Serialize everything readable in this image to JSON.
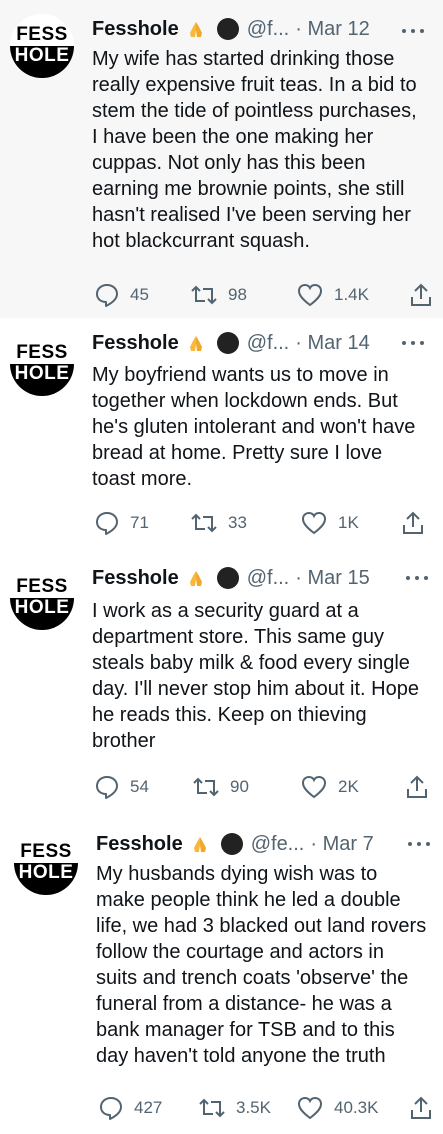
{
  "account": {
    "name": "Fesshole",
    "avatar_top": "FESS",
    "avatar_bottom": "HOLE"
  },
  "tweets": [
    {
      "handle": "@f...",
      "date": "· Mar 12",
      "text": "My wife has started drinking those\nreally expensive fruit teas. In a bid to\nstem the tide of pointless purchases,\nI have been the one making her\ncuppas. Not only has this been\nearning me brownie points, she still\nhasn't realised I've been serving her\nhot blackcurrant squash.",
      "replies": "45",
      "retweets": "98",
      "likes": "1.4K"
    },
    {
      "handle": "@f...",
      "date": "· Mar 14",
      "text": "My boyfriend wants us to move in\ntogether when lockdown ends. But\nhe's gluten intolerant and won't have\nbread at home. Pretty sure I love\ntoast more.",
      "replies": "71",
      "retweets": "33",
      "likes": "1K"
    },
    {
      "handle": "@f...",
      "date": "· Mar 15",
      "text": "I work as a security guard at a\ndepartment store. This same guy\nsteals baby milk & food every single\nday. I'll never stop him about it. Hope\nhe reads this. Keep on thieving\nbrother",
      "replies": "54",
      "retweets": "90",
      "likes": "2K"
    },
    {
      "handle": "@fe...",
      "date": "· Mar 7",
      "text": "My husbands dying wish was to\nmake people think he led a double\nlife, we had 3 blacked out land rovers\nfollow the courtage and actors in\nsuits and trench coats 'observe' the\nfuneral from a distance- he was a\nbank manager for TSB and to this\nday haven't told anyone the truth",
      "replies": "427",
      "retweets": "3.5K",
      "likes": "40.3K"
    }
  ],
  "icons": {
    "reply": "reply-icon",
    "retweet": "retweet-icon",
    "like": "heart-icon",
    "share": "share-icon",
    "more": "more-icon",
    "emoji": "folded-hands-icon",
    "dot": "black-circle-icon"
  },
  "colors": {
    "text": "#0f1419",
    "secondary": "#536471",
    "shaded_bg": "#f7f7f7",
    "emoji": "#f6b93b"
  }
}
